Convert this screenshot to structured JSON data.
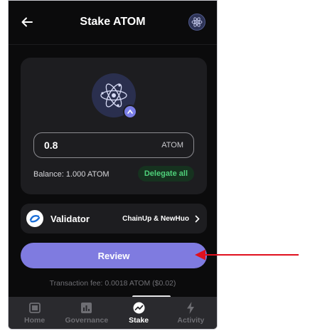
{
  "header": {
    "title": "Stake ATOM"
  },
  "stake": {
    "amount_value": "0.8",
    "amount_unit": "ATOM",
    "balance_text": "Balance: 1.000 ATOM",
    "delegate_all_label": "Delegate all"
  },
  "validator": {
    "label": "Validator",
    "name": "ChainUp & NewHuo"
  },
  "review_button_label": "Review",
  "fee_text": "Transaction fee: 0.0018 ATOM ($0.02)",
  "tabs": [
    {
      "label": "Home",
      "icon": "wallet-icon"
    },
    {
      "label": "Governance",
      "icon": "chart-icon"
    },
    {
      "label": "Stake",
      "icon": "stake-icon",
      "active": true
    },
    {
      "label": "Activity",
      "icon": "lightning-icon"
    }
  ],
  "colors": {
    "background": "#0b0b0c",
    "card": "#1d1d20",
    "accent": "#7f7be0",
    "success": "#4fd07a",
    "annotation_arrow": "#e0101e"
  }
}
